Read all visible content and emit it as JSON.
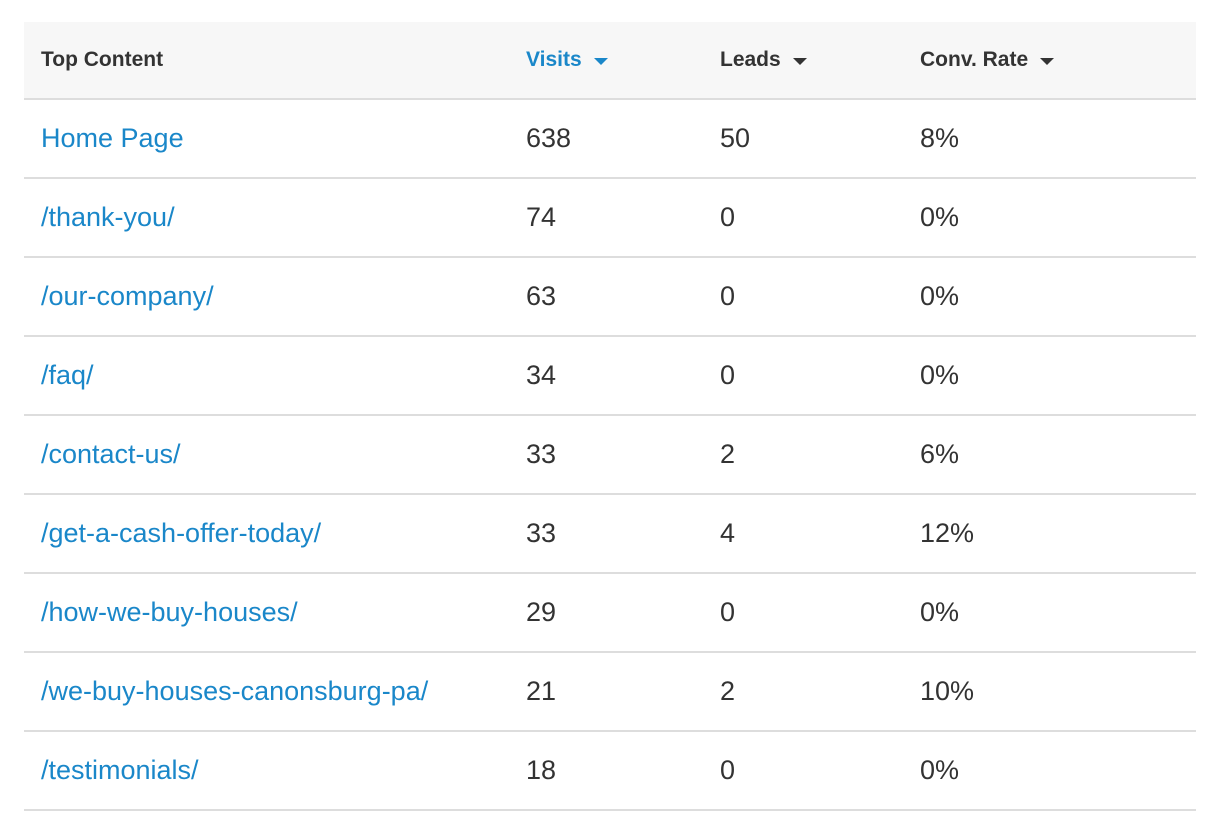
{
  "table": {
    "headers": {
      "content": "Top Content",
      "visits": "Visits",
      "leads": "Leads",
      "conv_rate": "Conv. Rate"
    },
    "sorted_by": "visits",
    "colors": {
      "link": "#1a87c9",
      "text": "#333333",
      "header_bg": "#f7f7f7"
    },
    "rows": [
      {
        "page": "Home Page",
        "visits": "638",
        "leads": "50",
        "conv_rate": "8%"
      },
      {
        "page": "/thank-you/",
        "visits": "74",
        "leads": "0",
        "conv_rate": "0%"
      },
      {
        "page": "/our-company/",
        "visits": "63",
        "leads": "0",
        "conv_rate": "0%"
      },
      {
        "page": "/faq/",
        "visits": "34",
        "leads": "0",
        "conv_rate": "0%"
      },
      {
        "page": "/contact-us/",
        "visits": "33",
        "leads": "2",
        "conv_rate": "6%"
      },
      {
        "page": "/get-a-cash-offer-today/",
        "visits": "33",
        "leads": "4",
        "conv_rate": "12%"
      },
      {
        "page": "/how-we-buy-houses/",
        "visits": "29",
        "leads": "0",
        "conv_rate": "0%"
      },
      {
        "page": "/we-buy-houses-canonsburg-pa/",
        "visits": "21",
        "leads": "2",
        "conv_rate": "10%"
      },
      {
        "page": "/testimonials/",
        "visits": "18",
        "leads": "0",
        "conv_rate": "0%"
      }
    ]
  }
}
